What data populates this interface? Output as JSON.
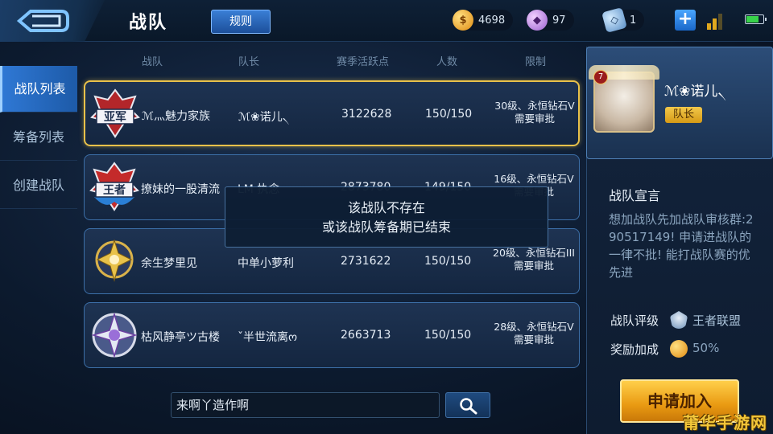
{
  "header": {
    "title": "战队",
    "rules_label": "规则",
    "gold": "4698",
    "gems": "97",
    "coupons": "1"
  },
  "sidebar": {
    "items": [
      {
        "label": "战队列表",
        "active": true
      },
      {
        "label": "筹备列表",
        "active": false
      },
      {
        "label": "创建战队",
        "active": false
      }
    ]
  },
  "table": {
    "columns": [
      "战队",
      "队长",
      "赛季活跃点",
      "人数",
      "限制"
    ],
    "rows": [
      {
        "badge": "亚军",
        "name": "ℳ灬魅力家族",
        "leader": "ℳ❀诺儿৲",
        "score": "3122628",
        "count": "150/150",
        "limit_1": "30级、永恒钻石V",
        "limit_2": "需要审批"
      },
      {
        "badge": "王者",
        "name": "撩妹的一股清流",
        "leader": "LM 执念",
        "score": "2873780",
        "count": "149/150",
        "limit_1": "16级、永恒钻石V",
        "limit_2": "需要审批"
      },
      {
        "badge": "",
        "name": "余生梦里见",
        "leader": "中单小萝利",
        "score": "2731622",
        "count": "150/150",
        "limit_1": "20级、永恒钻石III",
        "limit_2": "需要审批"
      },
      {
        "badge": "",
        "name": "枯风静亭ツ古楼",
        "leader": "ˇ半世流离ო",
        "score": "2663713",
        "count": "150/150",
        "limit_1": "28级、永恒钻石V",
        "limit_2": "需要审批"
      }
    ]
  },
  "popup": {
    "line1": "该战队不存在",
    "line2": "或该战队筹备期已结束"
  },
  "search": {
    "value": "来啊丫造作啊"
  },
  "panel": {
    "level": "7",
    "leader_name": "ℳ❀诺儿৲",
    "leader_tag": "队长",
    "declaration_title": "战队宣言",
    "declaration": "想加战队先加战队审核群:290517149! 申请进战队的一律不批! 能打战队赛的优先进",
    "rank_label": "战队评级",
    "rank_value": "王者联盟",
    "bonus_label": "奖励加成",
    "bonus_value": "50%",
    "join_label": "申请加入"
  },
  "watermark": "莆华手游网",
  "colors": {
    "selected_border": "#e8c14a",
    "accent_blue": "#2f78d4",
    "join_button": "#f2b428"
  }
}
